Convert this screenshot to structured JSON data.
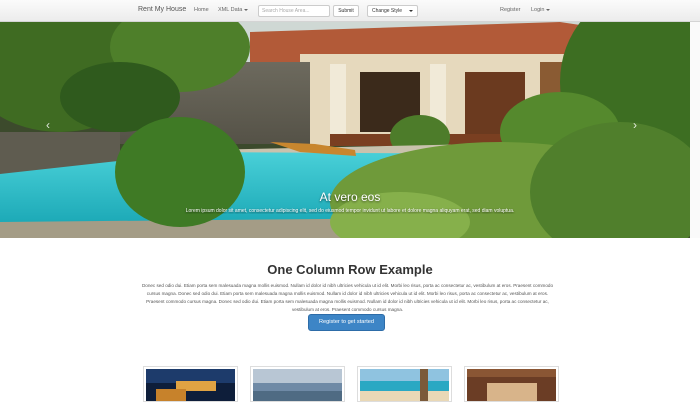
{
  "navbar": {
    "brand": "Rent My House",
    "links": {
      "home": "Home",
      "xml_data": "XML Data",
      "register": "Register",
      "login": "Login"
    },
    "search": {
      "placeholder": "Search House Area...",
      "submit_label": "Submit"
    },
    "style_select": {
      "selected": "Change Style"
    }
  },
  "carousel": {
    "caption_title": "At vero eos",
    "caption_text": "Lorem ipsum dolor sit amet, consectetur adipiscing elit, sed do eiusmod tempor invidunt ut labore et dolore magna aliquyam erat, sed diam voluptua.",
    "prev_glyph": "‹",
    "next_glyph": "›"
  },
  "main": {
    "title": "One Column Row Example",
    "paragraph": "Donec sed odio dui. Etiam porta sem malesuada magna mollis euismod. Nullam id dolor id nibh ultricies vehicula ut id elit. Morbi leo risus, porta ac consectetur ac, vestibulum at eros. Praesent commodo cursus magna. Donec sed odio dui. Etiam porta sem malesuada magna mollis euismod. Nullam id dolor id nibh ultricies vehicula ut id elit. Morbi leo risus, porta ac consectetur ac, vestibulum at eros. Praesent commodo cursus magna. Donec sed odio dui. Etiam porta sem malesuada magna mollis euismod. Nullam id dolor id nibh ultricies vehicula ut id elit. Morbi leo risus, porta ac consectetur ac, vestibulum at eros. Praesent commodo cursus magna.",
    "cta_label": "Register to get started"
  },
  "colors": {
    "primary_button": "#3d85c6",
    "navbar_bg": "#f4f4f4"
  }
}
